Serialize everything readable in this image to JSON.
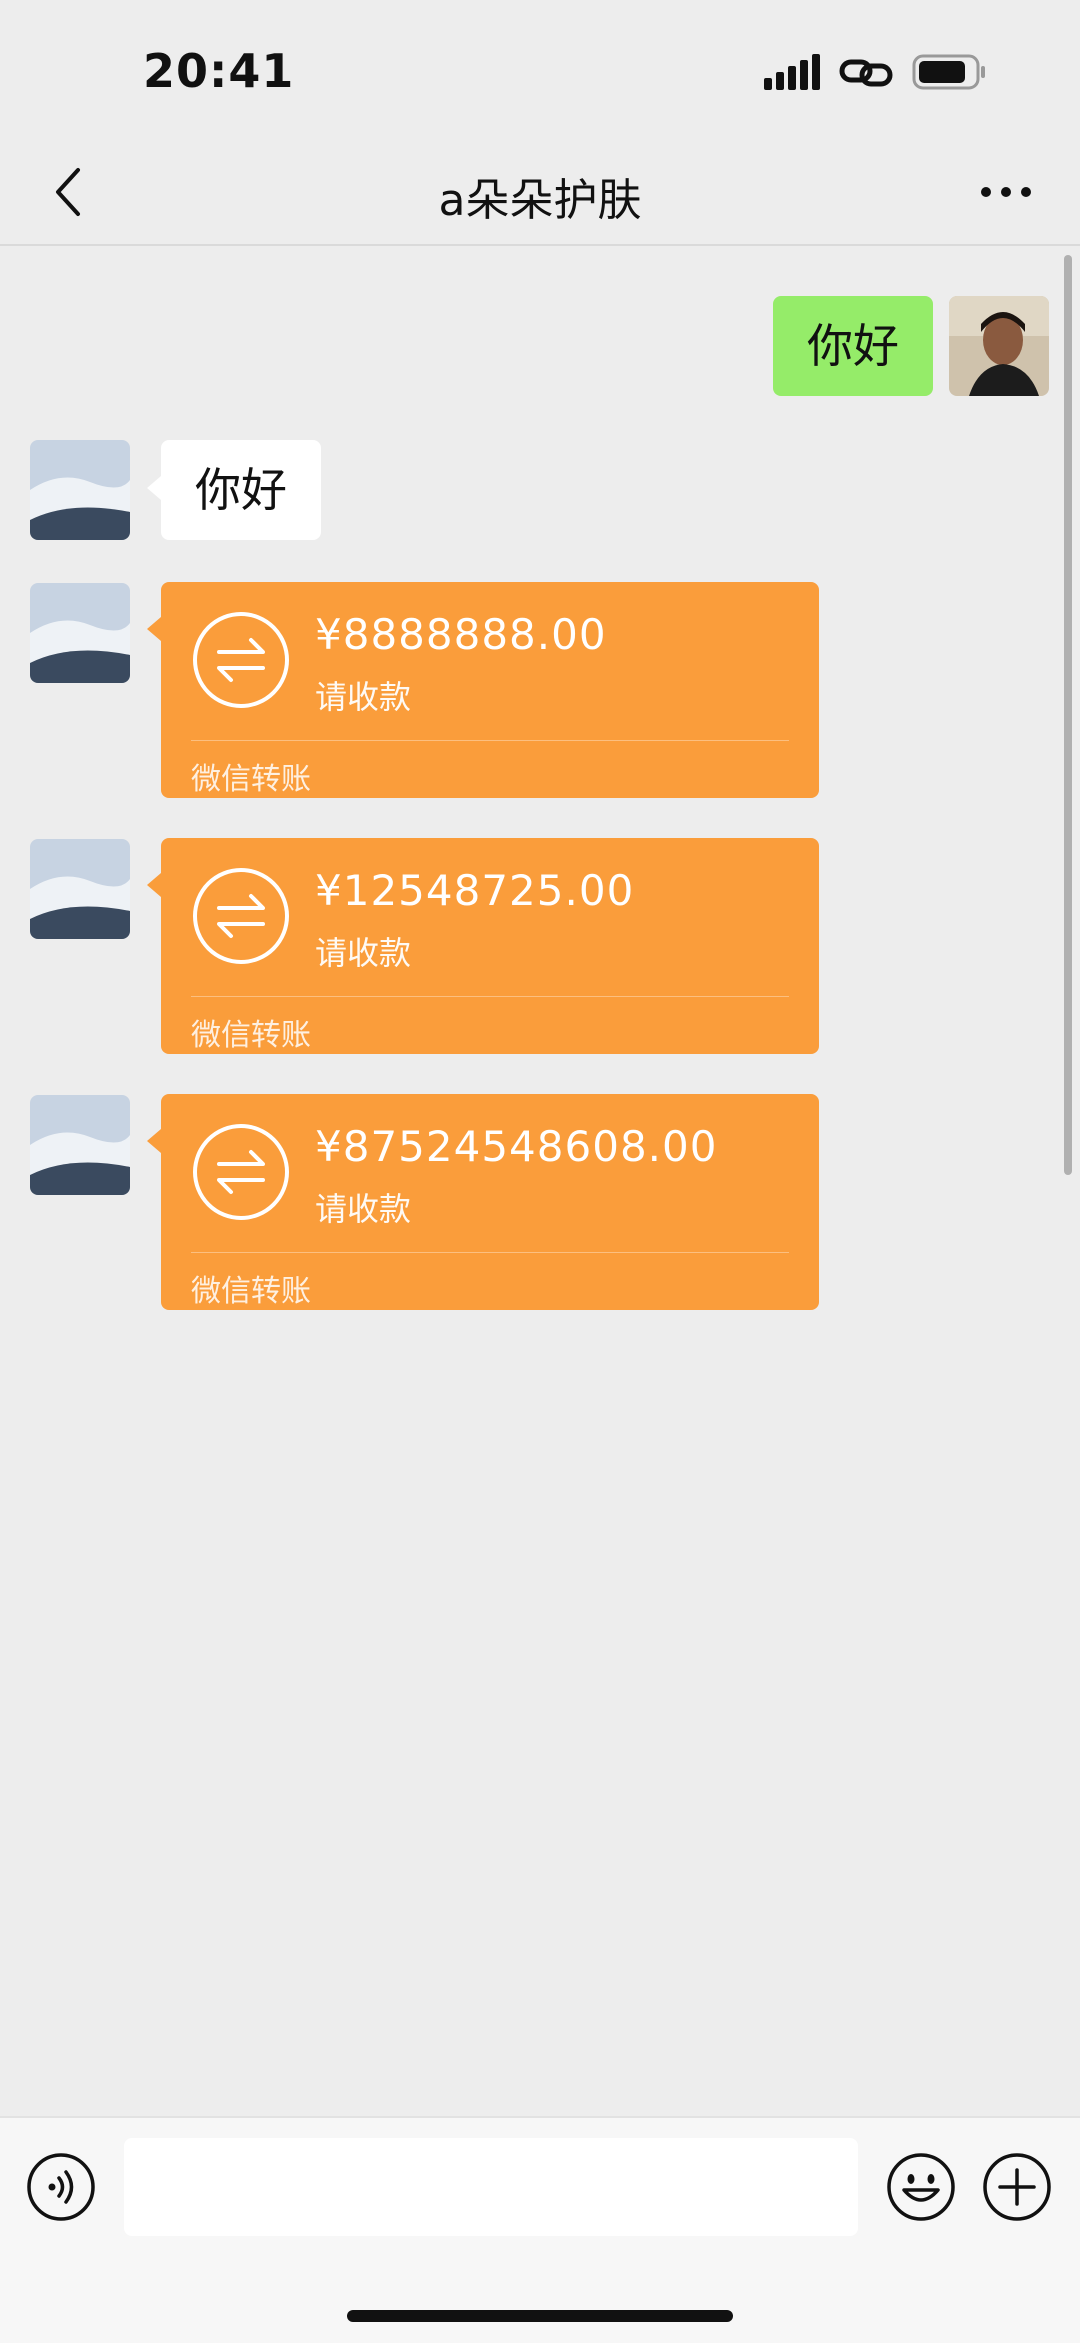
{
  "status_bar": {
    "time": "20:41"
  },
  "header": {
    "title": "a朵朵护肤"
  },
  "messages": [
    {
      "side": "right",
      "type": "text",
      "text": "你好"
    },
    {
      "side": "left",
      "type": "text",
      "text": "你好"
    },
    {
      "side": "left",
      "type": "transfer",
      "amount": "¥8888888.00",
      "status": "请收款",
      "label": "微信转账"
    },
    {
      "side": "left",
      "type": "transfer",
      "amount": "¥12548725.00",
      "status": "请收款",
      "label": "微信转账"
    },
    {
      "side": "left",
      "type": "transfer",
      "amount": "¥87524548608.00",
      "status": "请收款",
      "label": "微信转账"
    }
  ],
  "input_bar": {
    "value": ""
  },
  "colors": {
    "background": "#ededed",
    "outgoing_bubble": "#95ec69",
    "incoming_bubble": "#ffffff",
    "transfer_card": "#fa9d3b"
  },
  "icons": [
    "back-icon",
    "more-icon",
    "voice-icon",
    "emoji-icon",
    "plus-icon",
    "transfer-icon",
    "signal-icon",
    "link-icon",
    "battery-icon"
  ]
}
